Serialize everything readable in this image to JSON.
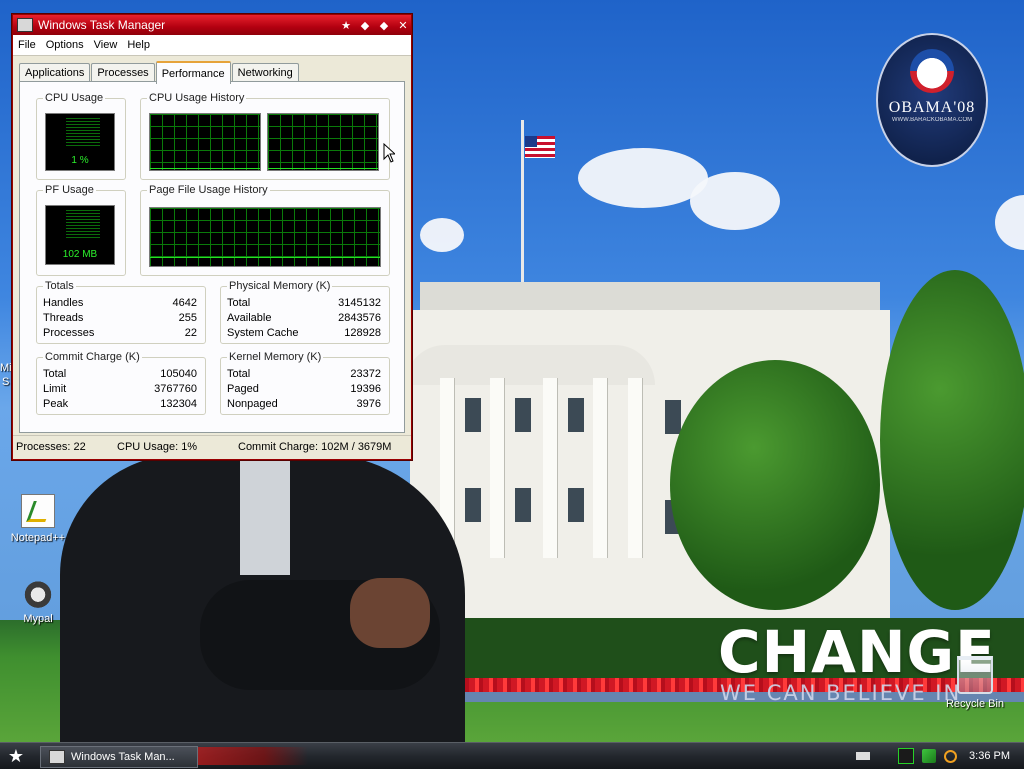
{
  "desktop": {
    "icons": [
      {
        "label": "Notepad++"
      },
      {
        "label": "Mypal"
      },
      {
        "label": "Recycle Bin"
      }
    ],
    "wallpaper": {
      "logo_text": "OBAMA'08",
      "logo_subtext": "WWW.BARACKOBAMA.COM",
      "headline": "CHANGE",
      "tagline": "WE CAN BELIEVE IN"
    },
    "partial_icon_labels": [
      "Mi",
      "S"
    ]
  },
  "taskmanager": {
    "title": "Windows Task Manager",
    "menu": [
      "File",
      "Options",
      "View",
      "Help"
    ],
    "tabs": [
      {
        "label": "Applications",
        "active": false
      },
      {
        "label": "Processes",
        "active": false
      },
      {
        "label": "Performance",
        "active": true
      },
      {
        "label": "Networking",
        "active": false
      }
    ],
    "cpu_usage": {
      "label": "CPU Usage",
      "value": "1 %"
    },
    "cpu_history": {
      "label": "CPU Usage History"
    },
    "pf_usage": {
      "label": "PF Usage",
      "value": "102 MB"
    },
    "pf_history": {
      "label": "Page File Usage History"
    },
    "totals": {
      "label": "Totals",
      "rows": [
        {
          "name": "Handles",
          "value": "4642"
        },
        {
          "name": "Threads",
          "value": "255"
        },
        {
          "name": "Processes",
          "value": "22"
        }
      ]
    },
    "physical_memory": {
      "label": "Physical Memory (K)",
      "rows": [
        {
          "name": "Total",
          "value": "3145132"
        },
        {
          "name": "Available",
          "value": "2843576"
        },
        {
          "name": "System Cache",
          "value": "128928"
        }
      ]
    },
    "commit_charge": {
      "label": "Commit Charge (K)",
      "rows": [
        {
          "name": "Total",
          "value": "105040"
        },
        {
          "name": "Limit",
          "value": "3767760"
        },
        {
          "name": "Peak",
          "value": "132304"
        }
      ]
    },
    "kernel_memory": {
      "label": "Kernel Memory (K)",
      "rows": [
        {
          "name": "Total",
          "value": "23372"
        },
        {
          "name": "Paged",
          "value": "19396"
        },
        {
          "name": "Nonpaged",
          "value": "3976"
        }
      ]
    },
    "status": {
      "processes": "Processes: 22",
      "cpu": "CPU Usage: 1%",
      "commit": "Commit Charge: 102M / 3679M"
    }
  },
  "taskbar": {
    "task_label": "Windows Task Man...",
    "clock": "3:36 PM"
  },
  "colors": {
    "titlebar": "#c0101c",
    "graph_green": "#25e025"
  }
}
